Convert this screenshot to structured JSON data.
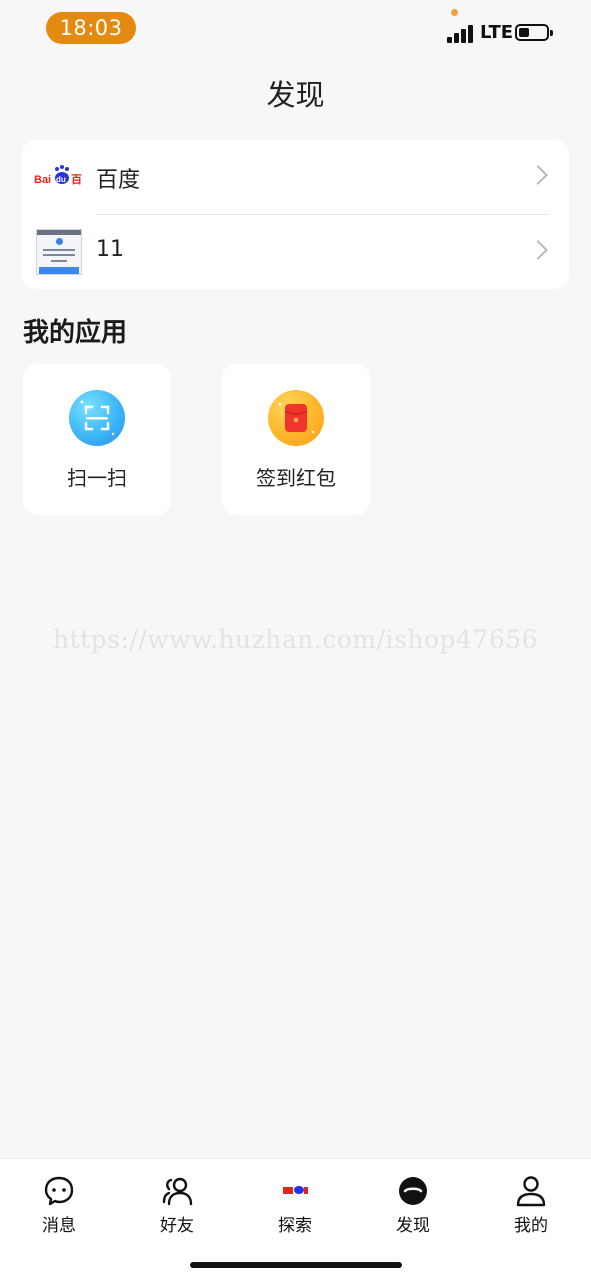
{
  "status_bar": {
    "time": "18:03",
    "network": "LTE",
    "battery_percent": 40
  },
  "header": {
    "title": "发现"
  },
  "links": [
    {
      "label": "百度",
      "icon": "baidu-logo"
    },
    {
      "label": "11",
      "icon": "webpage-thumbnail"
    }
  ],
  "baidu_logo_text": {
    "bai": "Bai",
    "du": "du",
    "e": "百"
  },
  "my_apps": {
    "title": "我的应用",
    "items": [
      {
        "label": "扫一扫",
        "icon": "scan-icon",
        "color": "#3cb6f6"
      },
      {
        "label": "签到红包",
        "icon": "red-envelope-icon",
        "color": "#ffb52a"
      }
    ]
  },
  "watermark": "https://www.huzhan.com/ishop47656",
  "tabbar": {
    "items": [
      {
        "label": "消息",
        "icon": "chat-bubble-icon"
      },
      {
        "label": "好友",
        "icon": "friends-icon"
      },
      {
        "label": "探索",
        "icon": "baidu-explore-icon"
      },
      {
        "label": "发现",
        "icon": "discover-icon",
        "active": true
      },
      {
        "label": "我的",
        "icon": "profile-icon"
      }
    ]
  }
}
